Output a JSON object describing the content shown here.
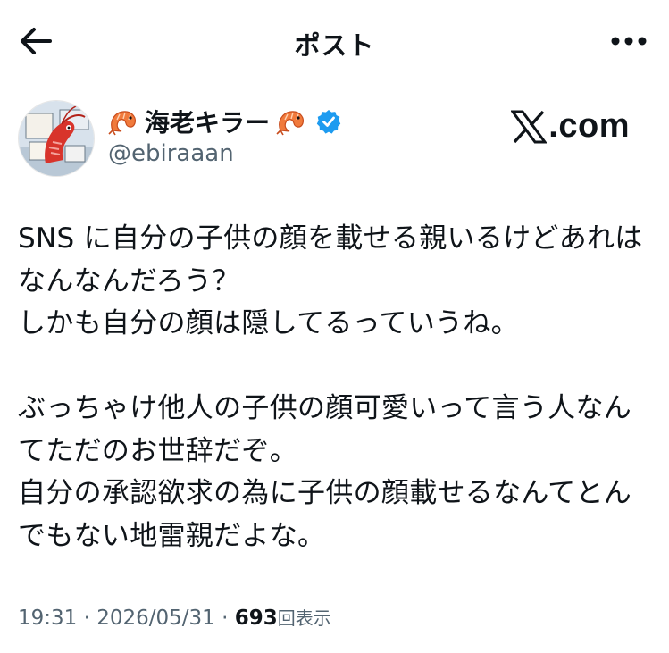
{
  "header": {
    "title": "ポスト",
    "back_icon": "arrow-left-icon",
    "more_icon": "more-horizontal-icon"
  },
  "author": {
    "display_name": "海老キラー",
    "handle": "@ebiraaan",
    "verified": true,
    "verified_color": "#1d9bf0",
    "name_emoji": "shrimp-icon"
  },
  "watermark": {
    "text": ".com",
    "logo": "x-logo-icon"
  },
  "tweet": {
    "text": "SNS に自分の子供の顔を載せる親いるけどあれはなんなんだろう？\nしかも自分の顔は隠してるっていうね。\n\nぶっちゃけ他人の子供の顔可愛いって言う人なんてただのお世辞だぞ。\n自分の承認欲求の為に子供の顔載せるなんてとんでもない地雷親だよな。",
    "time": "19:31",
    "separator": "·",
    "date": "2026/05/31",
    "views_count": "693",
    "views_label": "回表示"
  },
  "colors": {
    "text": "#0f1419",
    "secondary": "#536471",
    "accent": "#1d9bf0"
  }
}
